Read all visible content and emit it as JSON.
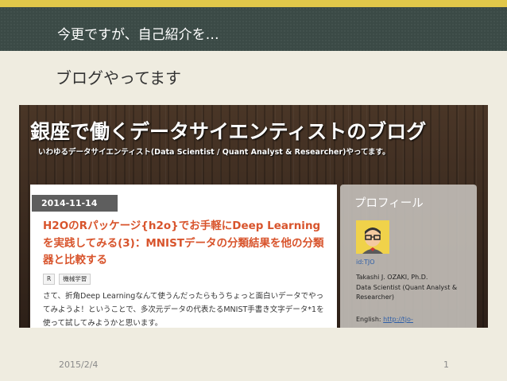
{
  "slide": {
    "title": "今更ですが、自己紹介を…",
    "subtitle": "ブログやってます",
    "footer_date": "2015/2/4",
    "page_number": "1"
  },
  "blog": {
    "title": "銀座で働くデータサイエンティストのブログ",
    "tagline": "いわゆるデータサイエンティスト(Data Scientist / Quant Analyst & Researcher)やってます。",
    "post": {
      "date": "2014-11-14",
      "title": "H2OのRパッケージ{h2o}でお手軽にDeep Learningを実践してみる(3)：MNISTデータの分類結果を他の分類器と比較する",
      "tags": [
        "R",
        "機械学習"
      ],
      "excerpt": "さて、折角Deep Learningなんて使うんだったらもうちょっと面白いデータでやってみようよ！ということで、多次元データの代表たるMNIST手書き文字データ*1を使って試してみようかと思います。"
    },
    "sidebar": {
      "heading": "プロフィール",
      "id": "id:TJO",
      "name": "Takashi J. OZAKI, Ph.D.",
      "role_line1": "Data Scientist (Quant Analyst &",
      "role_line2": "Researcher)",
      "english_label": "English:",
      "english_link": "http://tjo-"
    }
  },
  "colors": {
    "accent_band": "#e2c84a",
    "header_band": "#3b4a46",
    "post_title": "#d8542c",
    "link": "#2f5fa7"
  }
}
